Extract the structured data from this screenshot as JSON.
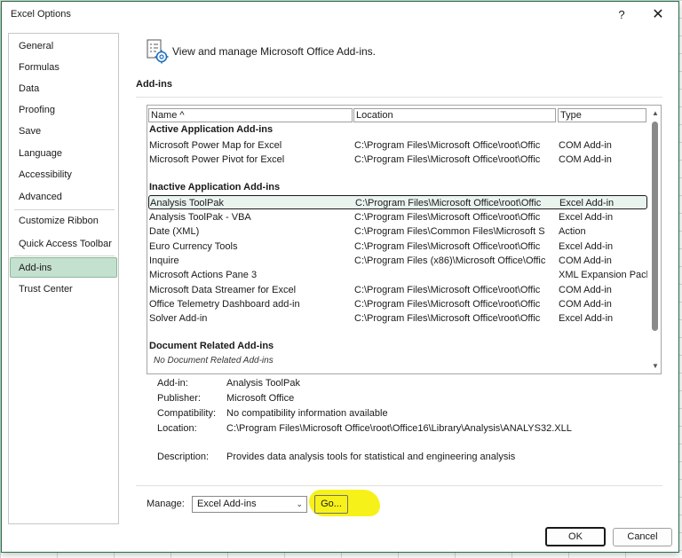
{
  "window": {
    "title": "Excel Options",
    "help_label": "?",
    "close_label": "✕"
  },
  "sidebar": {
    "items": [
      {
        "label": "General"
      },
      {
        "label": "Formulas"
      },
      {
        "label": "Data"
      },
      {
        "label": "Proofing"
      },
      {
        "label": "Save"
      },
      {
        "label": "Language"
      },
      {
        "label": "Accessibility"
      },
      {
        "label": "Advanced"
      },
      {
        "label": "Customize Ribbon"
      },
      {
        "label": "Quick Access Toolbar"
      },
      {
        "label": "Add-ins"
      },
      {
        "label": "Trust Center"
      }
    ],
    "selected": "Add-ins"
  },
  "main": {
    "header_text": "View and manage Microsoft Office Add-ins.",
    "section_title": "Add-ins"
  },
  "table": {
    "columns": [
      "Name ^",
      "Location",
      "Type"
    ],
    "groups": [
      {
        "title": "Active Application Add-ins",
        "rows": [
          {
            "name": "Microsoft Power Map for Excel",
            "location": "C:\\Program Files\\Microsoft Office\\root\\Offic",
            "type": "COM Add-in"
          },
          {
            "name": "Microsoft Power Pivot for Excel",
            "location": "C:\\Program Files\\Microsoft Office\\root\\Offic",
            "type": "COM Add-in"
          }
        ]
      },
      {
        "title": "Inactive Application Add-ins",
        "rows": [
          {
            "name": "Analysis ToolPak",
            "location": "C:\\Program Files\\Microsoft Office\\root\\Offic",
            "type": "Excel Add-in",
            "selected": true
          },
          {
            "name": "Analysis ToolPak - VBA",
            "location": "C:\\Program Files\\Microsoft Office\\root\\Offic",
            "type": "Excel Add-in"
          },
          {
            "name": "Date (XML)",
            "location": "C:\\Program Files\\Common Files\\Microsoft S",
            "type": "Action"
          },
          {
            "name": "Euro Currency Tools",
            "location": "C:\\Program Files\\Microsoft Office\\root\\Offic",
            "type": "Excel Add-in"
          },
          {
            "name": "Inquire",
            "location": "C:\\Program Files (x86)\\Microsoft Office\\Offic",
            "type": "COM Add-in"
          },
          {
            "name": "Microsoft Actions Pane 3",
            "location": "",
            "type": "XML Expansion Pack"
          },
          {
            "name": "Microsoft Data Streamer for Excel",
            "location": "C:\\Program Files\\Microsoft Office\\root\\Offic",
            "type": "COM Add-in"
          },
          {
            "name": "Office Telemetry Dashboard add-in",
            "location": "C:\\Program Files\\Microsoft Office\\root\\Offic",
            "type": "COM Add-in"
          },
          {
            "name": "Solver Add-in",
            "location": "C:\\Program Files\\Microsoft Office\\root\\Offic",
            "type": "Excel Add-in"
          }
        ]
      },
      {
        "title": "Document Related Add-ins",
        "empty_text": "No Document Related Add-ins",
        "rows": []
      }
    ]
  },
  "details": {
    "addin_label": "Add-in:",
    "addin_value": "Analysis ToolPak",
    "publisher_label": "Publisher:",
    "publisher_value": "Microsoft Office",
    "compat_label": "Compatibility:",
    "compat_value": "No compatibility information available",
    "location_label": "Location:",
    "location_value": "C:\\Program Files\\Microsoft Office\\root\\Office16\\Library\\Analysis\\ANALYS32.XLL",
    "description_label": "Description:",
    "description_value": "Provides data analysis tools for statistical and engineering analysis"
  },
  "manage": {
    "label": "Manage:",
    "selected": "Excel Add-ins",
    "go_label": "Go..."
  },
  "buttons": {
    "ok": "OK",
    "cancel": "Cancel"
  },
  "colors": {
    "accent": "#217346",
    "selected_nav": "#c4e0cf",
    "highlight": "#f7f11a"
  }
}
